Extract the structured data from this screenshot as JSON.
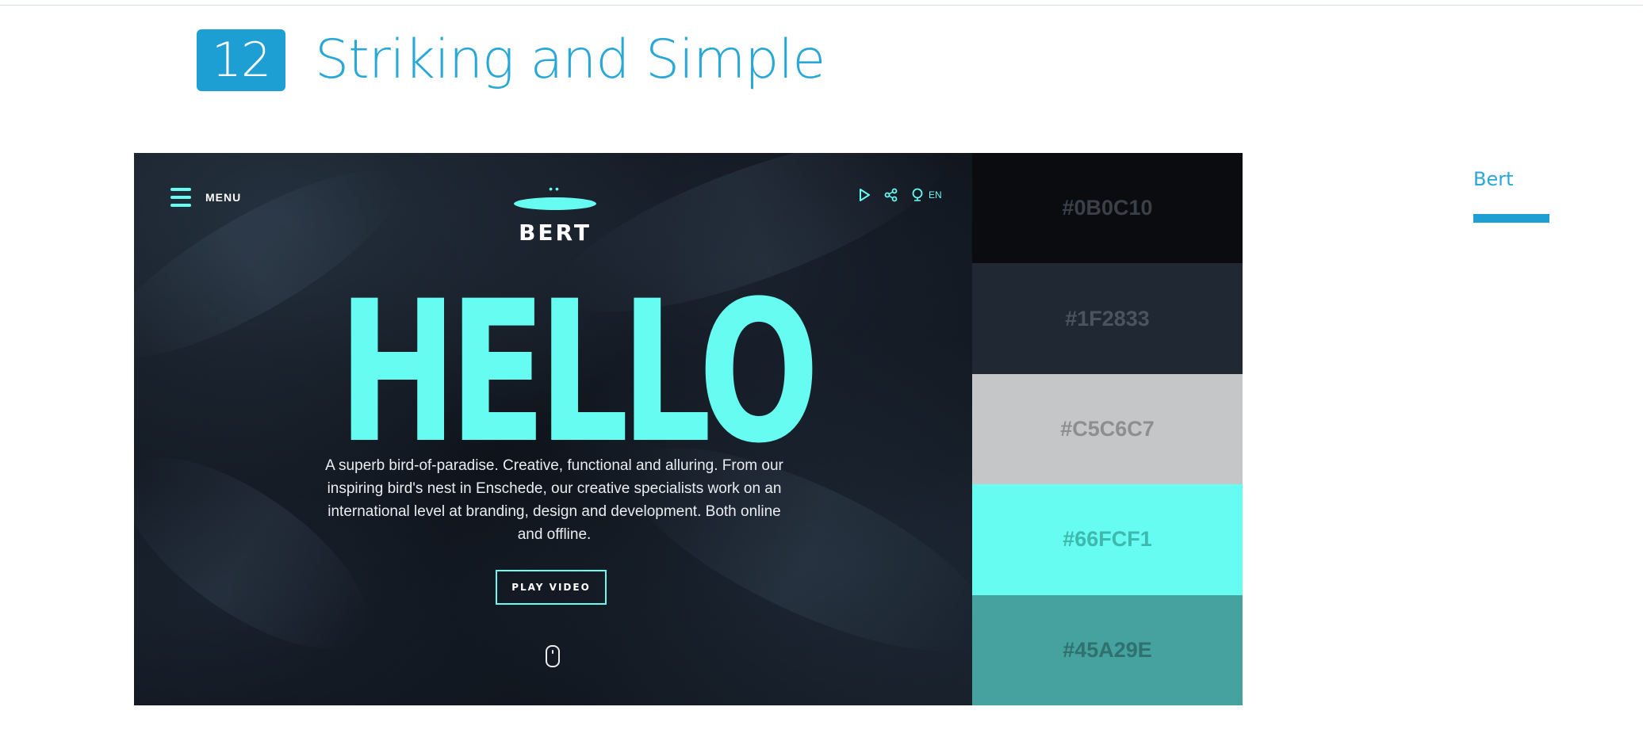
{
  "section": {
    "number": "12",
    "title": "Striking and Simple"
  },
  "preview": {
    "menu_label": "MENU",
    "logo_text": "BERT",
    "lang": "EN",
    "hero_text": "HELLO",
    "description": "A superb bird-of-paradise. Creative, functional and alluring. From our inspiring bird's nest in Enschede, our creative specialists work on an international level at branding, design and development. Both online and offline.",
    "play_button": "PLAY VIDEO"
  },
  "palette": {
    "swatches": [
      {
        "hex": "#0B0C10",
        "label": "#0B0C10",
        "text_color": "#3b4048"
      },
      {
        "hex": "#1F2833",
        "label": "#1F2833",
        "text_color": "#4a535e"
      },
      {
        "hex": "#C5C6C7",
        "label": "#C5C6C7",
        "text_color": "#8d8e90"
      },
      {
        "hex": "#66FCF1",
        "label": "#66FCF1",
        "text_color": "#3fb8ae"
      },
      {
        "hex": "#45A29E",
        "label": "#45A29E",
        "text_color": "#2f716e"
      }
    ]
  },
  "tabs": {
    "active_label": "Bert"
  },
  "colors": {
    "accent": "#1e9fd3",
    "teal": "#66fcf1"
  }
}
